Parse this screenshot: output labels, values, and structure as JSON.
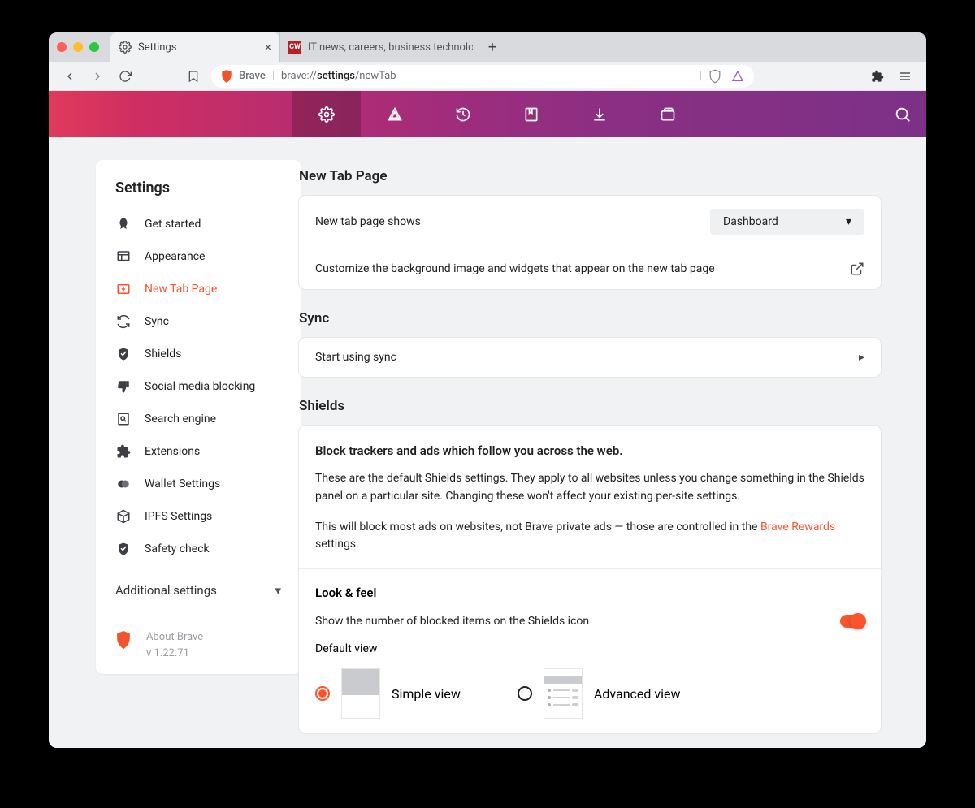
{
  "tabs": [
    {
      "label": "Settings",
      "active": true
    },
    {
      "label": "IT news, careers, business technolo",
      "active": false
    }
  ],
  "address": {
    "brand": "Brave",
    "scheme": "brave://",
    "path_bold": "settings",
    "path_rest": "/newTab"
  },
  "sidebar": {
    "title": "Settings",
    "items": [
      {
        "label": "Get started"
      },
      {
        "label": "Appearance"
      },
      {
        "label": "New Tab Page"
      },
      {
        "label": "Sync"
      },
      {
        "label": "Shields"
      },
      {
        "label": "Social media blocking"
      },
      {
        "label": "Search engine"
      },
      {
        "label": "Extensions"
      },
      {
        "label": "Wallet Settings"
      },
      {
        "label": "IPFS Settings"
      },
      {
        "label": "Safety check"
      }
    ],
    "additional": "Additional settings",
    "about_label": "About Brave",
    "about_version": "v 1.22.71"
  },
  "sections": {
    "newtab": {
      "title": "New Tab Page",
      "row1_label": "New tab page shows",
      "row1_value": "Dashboard",
      "row2_label": "Customize the background image and widgets that appear on the new tab page"
    },
    "sync": {
      "title": "Sync",
      "row1_label": "Start using sync"
    },
    "shields": {
      "title": "Shields",
      "heading": "Block trackers and ads which follow you across the web.",
      "body1": "These are the default Shields settings. They apply to all websites unless you change something in the Shields panel on a particular site. Changing these won't affect your existing per-site settings.",
      "body2_pre": "This will block most ads on websites, not Brave private ads — those are controlled in the ",
      "body2_link": "Brave Rewards",
      "body2_post": " settings.",
      "lookfeel_title": "Look & feel",
      "lookfeel_toggle_label": "Show the number of blocked items on the Shields icon",
      "default_view_label": "Default view",
      "view_simple": "Simple view",
      "view_advanced": "Advanced view"
    }
  }
}
